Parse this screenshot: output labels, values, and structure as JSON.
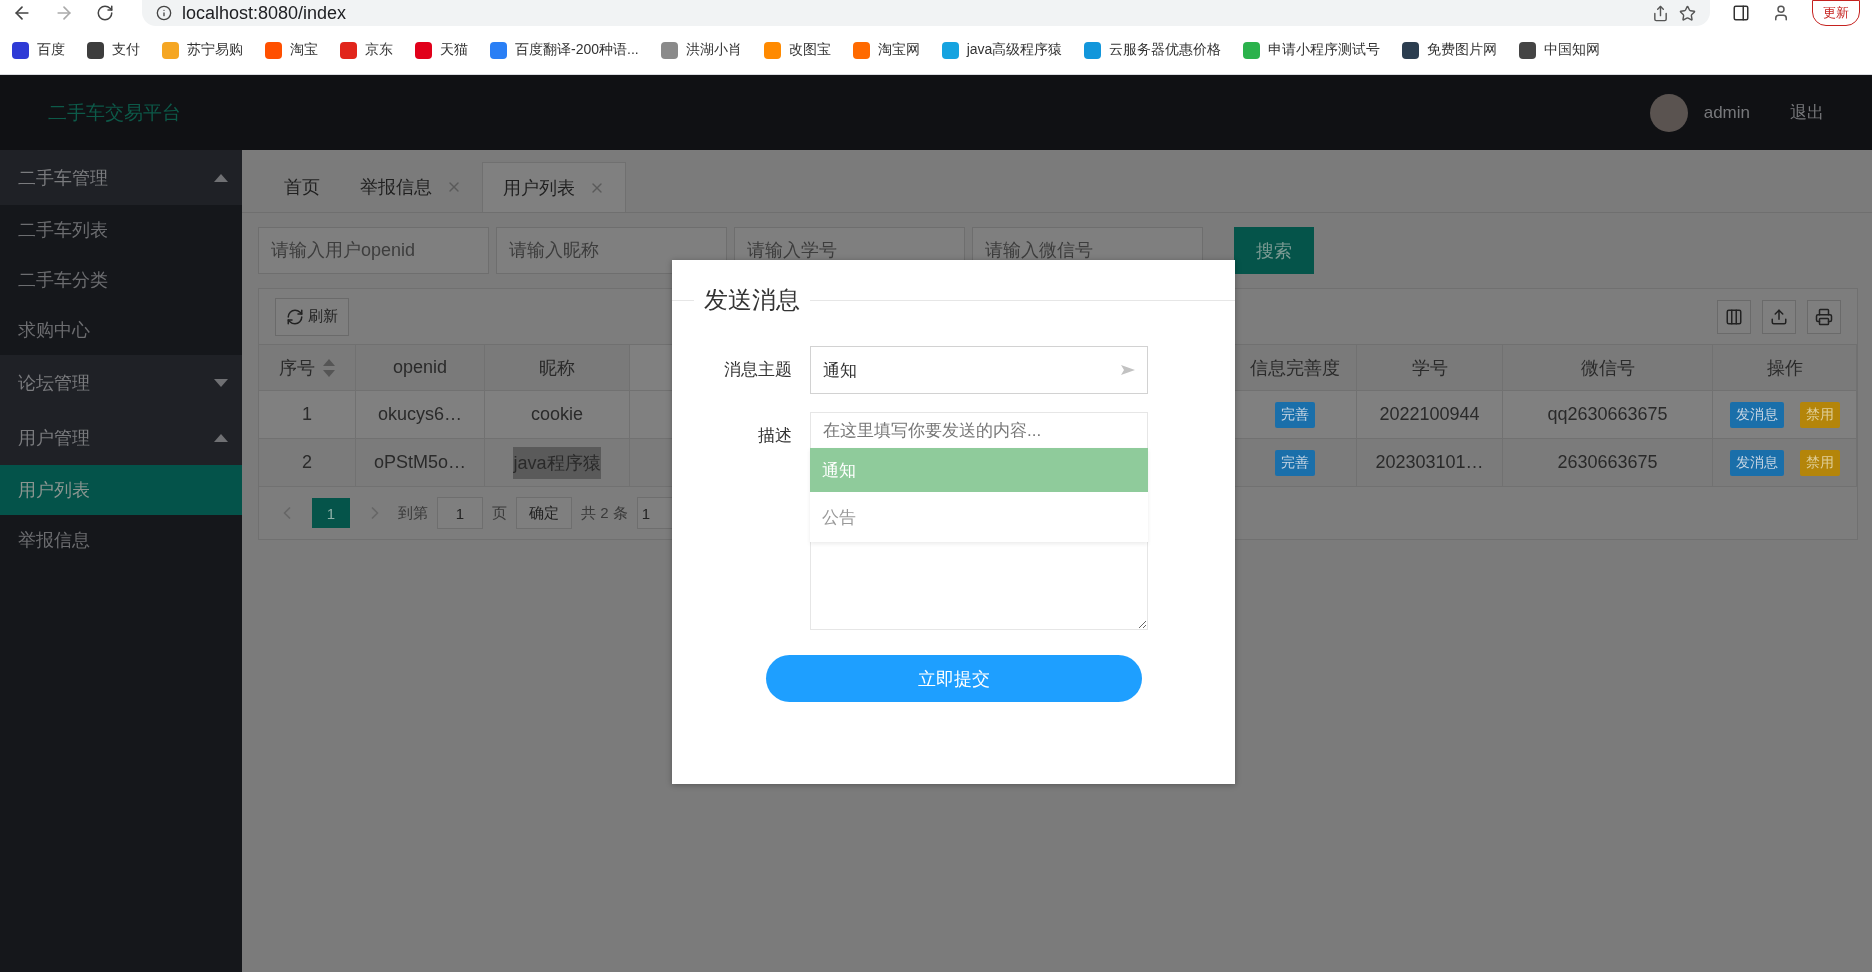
{
  "browser": {
    "url": "localhost:8080/index",
    "update_button": "更新",
    "bookmarks": [
      {
        "label": "百度",
        "color": "#2f3bd6"
      },
      {
        "label": "支付",
        "color": "#3d3d3d"
      },
      {
        "label": "苏宁易购",
        "color": "#f5a623"
      },
      {
        "label": "淘宝",
        "color": "#ff5000"
      },
      {
        "label": "京东",
        "color": "#e1251b"
      },
      {
        "label": "天猫",
        "color": "#e1001a"
      },
      {
        "label": "百度翻译-200种语...",
        "color": "#2a7ff5"
      },
      {
        "label": "洪湖小肖",
        "color": "#8a8a8a"
      },
      {
        "label": "改图宝",
        "color": "#ff8a00"
      },
      {
        "label": "淘宝网",
        "color": "#ff6a00"
      },
      {
        "label": "java高级程序猿",
        "color": "#16a3e0"
      },
      {
        "label": "云服务器优惠价格",
        "color": "#1296db"
      },
      {
        "label": "申请小程序测试号",
        "color": "#2bb24c"
      },
      {
        "label": "免费图片网",
        "color": "#2c3e50"
      },
      {
        "label": "中国知网",
        "color": "#444444"
      }
    ]
  },
  "header": {
    "logo": "二手车交易平台",
    "user": "admin",
    "logout": "退出"
  },
  "sidebar": {
    "groups": [
      {
        "label": "二手车管理",
        "expanded": true,
        "children": [
          {
            "label": "二手车列表",
            "selected": false
          },
          {
            "label": "二手车分类",
            "selected": false
          },
          {
            "label": "求购中心",
            "selected": false
          }
        ]
      },
      {
        "label": "论坛管理",
        "expanded": false
      },
      {
        "label": "用户管理",
        "expanded": true,
        "children": [
          {
            "label": "用户列表",
            "selected": true
          },
          {
            "label": "举报信息",
            "selected": false
          }
        ]
      }
    ]
  },
  "tabs": [
    {
      "label": "首页",
      "closable": false,
      "selected": false
    },
    {
      "label": "举报信息",
      "closable": true,
      "selected": false
    },
    {
      "label": "用户列表",
      "closable": true,
      "selected": true
    }
  ],
  "search": {
    "fields": [
      {
        "placeholder": "请输入用户openid"
      },
      {
        "placeholder": "请输入昵称"
      },
      {
        "placeholder": "请输入学号"
      },
      {
        "placeholder": "请输入微信号"
      }
    ],
    "button": "搜索"
  },
  "toolbar": {
    "refresh": "刷新"
  },
  "table": {
    "columns": [
      {
        "label": "序号",
        "sortable": true
      },
      {
        "label": "openid",
        "sortable": false
      },
      {
        "label": "昵称",
        "sortable": false
      },
      {
        "label": "信息完善度",
        "sortable": false
      },
      {
        "label": "学号",
        "sortable": false
      },
      {
        "label": "微信号",
        "sortable": false
      },
      {
        "label": "操作",
        "sortable": false
      }
    ],
    "rows": [
      {
        "index": "1",
        "openid": "okucys6…",
        "nickname": "cookie",
        "nickname_highlighted": false,
        "completeness": "完善",
        "student_no": "2022100944",
        "wechat": "qq2630663675",
        "actions": [
          "发消息",
          "禁用"
        ]
      },
      {
        "index": "2",
        "openid": "oPStM5o…",
        "nickname": "java程序猿",
        "nickname_highlighted": true,
        "completeness": "完善",
        "student_no": "202303101…",
        "wechat": "2630663675",
        "actions": [
          "发消息",
          "禁用"
        ]
      }
    ]
  },
  "pager": {
    "current": "1",
    "goto_label": "到第",
    "goto_value": "1",
    "page_label": "页",
    "confirm": "确定",
    "total": "共 2 条",
    "size": "1"
  },
  "dialog": {
    "title": "发送消息",
    "fields": [
      {
        "kind": "select",
        "label": "消息主题",
        "value": "通知",
        "options": [
          {
            "label": "通知",
            "selected": true
          },
          {
            "label": "公告",
            "selected": false
          }
        ]
      },
      {
        "kind": "textarea",
        "label": "描述",
        "placeholder": "在这里填写你要发送的内容..."
      }
    ],
    "submit": "立即提交"
  }
}
